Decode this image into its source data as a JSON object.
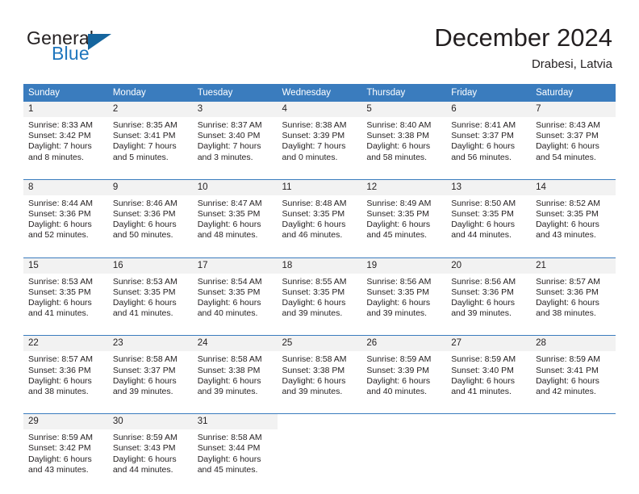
{
  "logo": {
    "word_top": "General",
    "word_bottom": "Blue",
    "triangle_icon": "triangle-icon",
    "brand_blue": "#1f76bd",
    "triangle_color": "#15659e"
  },
  "header": {
    "title": "December 2024",
    "location": "Drabesi, Latvia"
  },
  "theme": {
    "header_row_bg": "#3a7cbe",
    "daynum_bg": "#f2f2f2",
    "separator": "#3a7cbe",
    "text": "#231f20"
  },
  "calendar": {
    "weekday_headers": [
      "Sunday",
      "Monday",
      "Tuesday",
      "Wednesday",
      "Thursday",
      "Friday",
      "Saturday"
    ],
    "weeks": [
      [
        {
          "day": "1",
          "sunrise": "Sunrise: 8:33 AM",
          "sunset": "Sunset: 3:42 PM",
          "daylight1": "Daylight: 7 hours",
          "daylight2": "and 8 minutes."
        },
        {
          "day": "2",
          "sunrise": "Sunrise: 8:35 AM",
          "sunset": "Sunset: 3:41 PM",
          "daylight1": "Daylight: 7 hours",
          "daylight2": "and 5 minutes."
        },
        {
          "day": "3",
          "sunrise": "Sunrise: 8:37 AM",
          "sunset": "Sunset: 3:40 PM",
          "daylight1": "Daylight: 7 hours",
          "daylight2": "and 3 minutes."
        },
        {
          "day": "4",
          "sunrise": "Sunrise: 8:38 AM",
          "sunset": "Sunset: 3:39 PM",
          "daylight1": "Daylight: 7 hours",
          "daylight2": "and 0 minutes."
        },
        {
          "day": "5",
          "sunrise": "Sunrise: 8:40 AM",
          "sunset": "Sunset: 3:38 PM",
          "daylight1": "Daylight: 6 hours",
          "daylight2": "and 58 minutes."
        },
        {
          "day": "6",
          "sunrise": "Sunrise: 8:41 AM",
          "sunset": "Sunset: 3:37 PM",
          "daylight1": "Daylight: 6 hours",
          "daylight2": "and 56 minutes."
        },
        {
          "day": "7",
          "sunrise": "Sunrise: 8:43 AM",
          "sunset": "Sunset: 3:37 PM",
          "daylight1": "Daylight: 6 hours",
          "daylight2": "and 54 minutes."
        }
      ],
      [
        {
          "day": "8",
          "sunrise": "Sunrise: 8:44 AM",
          "sunset": "Sunset: 3:36 PM",
          "daylight1": "Daylight: 6 hours",
          "daylight2": "and 52 minutes."
        },
        {
          "day": "9",
          "sunrise": "Sunrise: 8:46 AM",
          "sunset": "Sunset: 3:36 PM",
          "daylight1": "Daylight: 6 hours",
          "daylight2": "and 50 minutes."
        },
        {
          "day": "10",
          "sunrise": "Sunrise: 8:47 AM",
          "sunset": "Sunset: 3:35 PM",
          "daylight1": "Daylight: 6 hours",
          "daylight2": "and 48 minutes."
        },
        {
          "day": "11",
          "sunrise": "Sunrise: 8:48 AM",
          "sunset": "Sunset: 3:35 PM",
          "daylight1": "Daylight: 6 hours",
          "daylight2": "and 46 minutes."
        },
        {
          "day": "12",
          "sunrise": "Sunrise: 8:49 AM",
          "sunset": "Sunset: 3:35 PM",
          "daylight1": "Daylight: 6 hours",
          "daylight2": "and 45 minutes."
        },
        {
          "day": "13",
          "sunrise": "Sunrise: 8:50 AM",
          "sunset": "Sunset: 3:35 PM",
          "daylight1": "Daylight: 6 hours",
          "daylight2": "and 44 minutes."
        },
        {
          "day": "14",
          "sunrise": "Sunrise: 8:52 AM",
          "sunset": "Sunset: 3:35 PM",
          "daylight1": "Daylight: 6 hours",
          "daylight2": "and 43 minutes."
        }
      ],
      [
        {
          "day": "15",
          "sunrise": "Sunrise: 8:53 AM",
          "sunset": "Sunset: 3:35 PM",
          "daylight1": "Daylight: 6 hours",
          "daylight2": "and 41 minutes."
        },
        {
          "day": "16",
          "sunrise": "Sunrise: 8:53 AM",
          "sunset": "Sunset: 3:35 PM",
          "daylight1": "Daylight: 6 hours",
          "daylight2": "and 41 minutes."
        },
        {
          "day": "17",
          "sunrise": "Sunrise: 8:54 AM",
          "sunset": "Sunset: 3:35 PM",
          "daylight1": "Daylight: 6 hours",
          "daylight2": "and 40 minutes."
        },
        {
          "day": "18",
          "sunrise": "Sunrise: 8:55 AM",
          "sunset": "Sunset: 3:35 PM",
          "daylight1": "Daylight: 6 hours",
          "daylight2": "and 39 minutes."
        },
        {
          "day": "19",
          "sunrise": "Sunrise: 8:56 AM",
          "sunset": "Sunset: 3:35 PM",
          "daylight1": "Daylight: 6 hours",
          "daylight2": "and 39 minutes."
        },
        {
          "day": "20",
          "sunrise": "Sunrise: 8:56 AM",
          "sunset": "Sunset: 3:36 PM",
          "daylight1": "Daylight: 6 hours",
          "daylight2": "and 39 minutes."
        },
        {
          "day": "21",
          "sunrise": "Sunrise: 8:57 AM",
          "sunset": "Sunset: 3:36 PM",
          "daylight1": "Daylight: 6 hours",
          "daylight2": "and 38 minutes."
        }
      ],
      [
        {
          "day": "22",
          "sunrise": "Sunrise: 8:57 AM",
          "sunset": "Sunset: 3:36 PM",
          "daylight1": "Daylight: 6 hours",
          "daylight2": "and 38 minutes."
        },
        {
          "day": "23",
          "sunrise": "Sunrise: 8:58 AM",
          "sunset": "Sunset: 3:37 PM",
          "daylight1": "Daylight: 6 hours",
          "daylight2": "and 39 minutes."
        },
        {
          "day": "24",
          "sunrise": "Sunrise: 8:58 AM",
          "sunset": "Sunset: 3:38 PM",
          "daylight1": "Daylight: 6 hours",
          "daylight2": "and 39 minutes."
        },
        {
          "day": "25",
          "sunrise": "Sunrise: 8:58 AM",
          "sunset": "Sunset: 3:38 PM",
          "daylight1": "Daylight: 6 hours",
          "daylight2": "and 39 minutes."
        },
        {
          "day": "26",
          "sunrise": "Sunrise: 8:59 AM",
          "sunset": "Sunset: 3:39 PM",
          "daylight1": "Daylight: 6 hours",
          "daylight2": "and 40 minutes."
        },
        {
          "day": "27",
          "sunrise": "Sunrise: 8:59 AM",
          "sunset": "Sunset: 3:40 PM",
          "daylight1": "Daylight: 6 hours",
          "daylight2": "and 41 minutes."
        },
        {
          "day": "28",
          "sunrise": "Sunrise: 8:59 AM",
          "sunset": "Sunset: 3:41 PM",
          "daylight1": "Daylight: 6 hours",
          "daylight2": "and 42 minutes."
        }
      ],
      [
        {
          "day": "29",
          "sunrise": "Sunrise: 8:59 AM",
          "sunset": "Sunset: 3:42 PM",
          "daylight1": "Daylight: 6 hours",
          "daylight2": "and 43 minutes."
        },
        {
          "day": "30",
          "sunrise": "Sunrise: 8:59 AM",
          "sunset": "Sunset: 3:43 PM",
          "daylight1": "Daylight: 6 hours",
          "daylight2": "and 44 minutes."
        },
        {
          "day": "31",
          "sunrise": "Sunrise: 8:58 AM",
          "sunset": "Sunset: 3:44 PM",
          "daylight1": "Daylight: 6 hours",
          "daylight2": "and 45 minutes."
        },
        {
          "day": "",
          "sunrise": "",
          "sunset": "",
          "daylight1": "",
          "daylight2": ""
        },
        {
          "day": "",
          "sunrise": "",
          "sunset": "",
          "daylight1": "",
          "daylight2": ""
        },
        {
          "day": "",
          "sunrise": "",
          "sunset": "",
          "daylight1": "",
          "daylight2": ""
        },
        {
          "day": "",
          "sunrise": "",
          "sunset": "",
          "daylight1": "",
          "daylight2": ""
        }
      ]
    ]
  }
}
